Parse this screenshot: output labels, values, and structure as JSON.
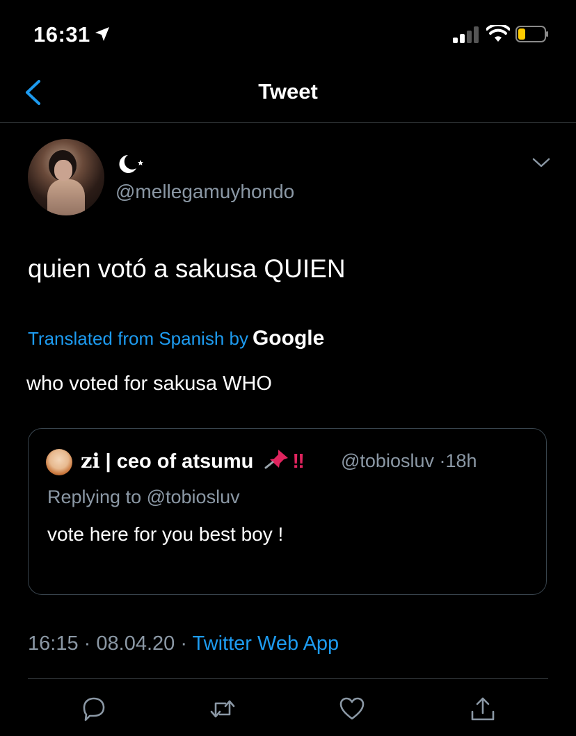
{
  "status_bar": {
    "time": "16:31"
  },
  "nav": {
    "title": "Tweet"
  },
  "tweet": {
    "display_name_icon": "crescent-moon-star-icon",
    "handle": "@mellegamuyhondo",
    "text": "quien votó a sakusa QUIEN",
    "translated_label": "Translated from Spanish by",
    "translated_brand": "Google",
    "translation": "who voted for sakusa WHO",
    "time": "16:15",
    "date": "08.04.20",
    "source": "Twitter Web App",
    "separator": "·"
  },
  "quote": {
    "name_prefix": "zi",
    "name_rest": " | ceo of atsumu",
    "name_emoji": "‼",
    "handle": "@tobiosluv",
    "age": "18h",
    "replying_label": "Replying to",
    "replying_handle": "@tobiosluv",
    "text": "vote here for you best boy !"
  },
  "colors": {
    "accent": "#1d9bf0",
    "muted": "#8b98a5",
    "background": "#000000",
    "border": "#38444d"
  },
  "icons": [
    "location-arrow-icon",
    "cellular-signal-icon",
    "wifi-icon",
    "battery-low-icon",
    "back-chevron-icon",
    "chevron-down-icon",
    "pushpin-icon",
    "reply-icon",
    "retweet-icon",
    "like-icon",
    "share-icon"
  ]
}
